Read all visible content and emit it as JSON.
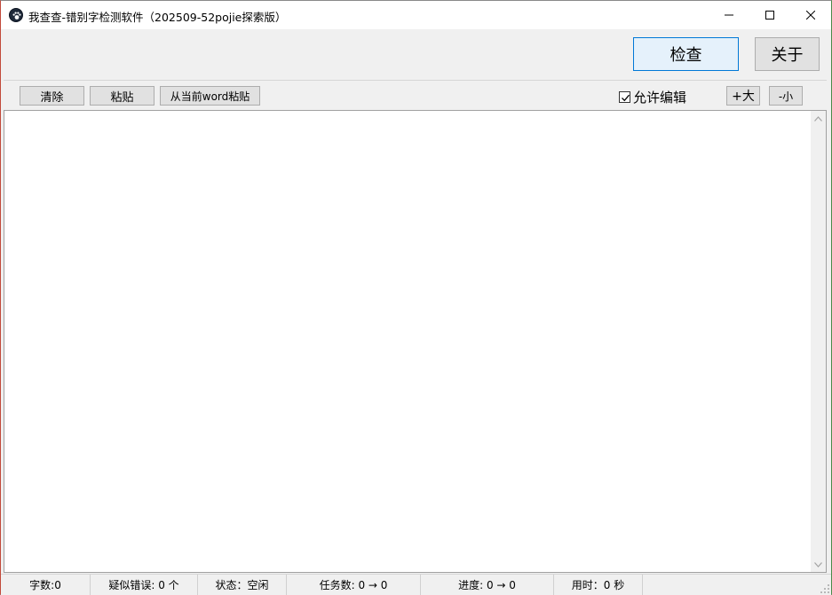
{
  "window": {
    "title": "我查查-错别字检测软件（202509-52pojie探索版）"
  },
  "actions": {
    "check_label": "检查",
    "about_label": "关于"
  },
  "toolbar": {
    "clear_label": "清除",
    "paste_label": "粘贴",
    "paste_word_label": "从当前word粘贴",
    "allow_edit_label": "允许编辑",
    "allow_edit_checked": true,
    "font_larger_label": "+大",
    "font_smaller_label": "-小"
  },
  "editor": {
    "content": ""
  },
  "status": {
    "char_count": "字数:0",
    "suspected_errors": "疑似错误: 0 个",
    "state": "状态：空闲",
    "tasks": "任务数: 0 → 0",
    "progress": "进度: 0 → 0",
    "elapsed": "用时：0 秒"
  },
  "colors": {
    "primary_border": "#0078d7",
    "primary_bg": "#e5f1fb",
    "window_bg": "#f0f0f0"
  }
}
